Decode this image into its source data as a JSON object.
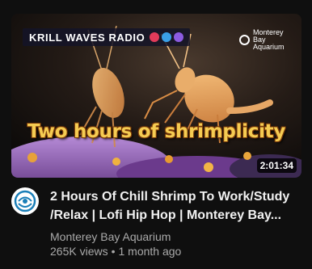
{
  "thumbnail": {
    "channel_badge": "KRILL WAVES RADIO",
    "badge_icons": [
      "shrimp-icon",
      "wave-icon",
      "music-icon"
    ],
    "brand_logo_text": "Monterey Bay Aquarium",
    "overlay_caption": "Two hours of shrimplicity",
    "duration": "2:01:34"
  },
  "video": {
    "title_line1": "2 Hours Of Chill Shrimp To Work/Study",
    "title_line2": "/Relax | Lofi Hip Hop | Monterey Bay...",
    "channel": "Monterey Bay Aquarium",
    "views": "265K views",
    "separator": "•",
    "age": "1 month ago"
  },
  "colors": {
    "background": "#0f0f0f",
    "title": "#f1f1f1",
    "meta": "#aaaaaa",
    "caption": "#f5cc52"
  }
}
